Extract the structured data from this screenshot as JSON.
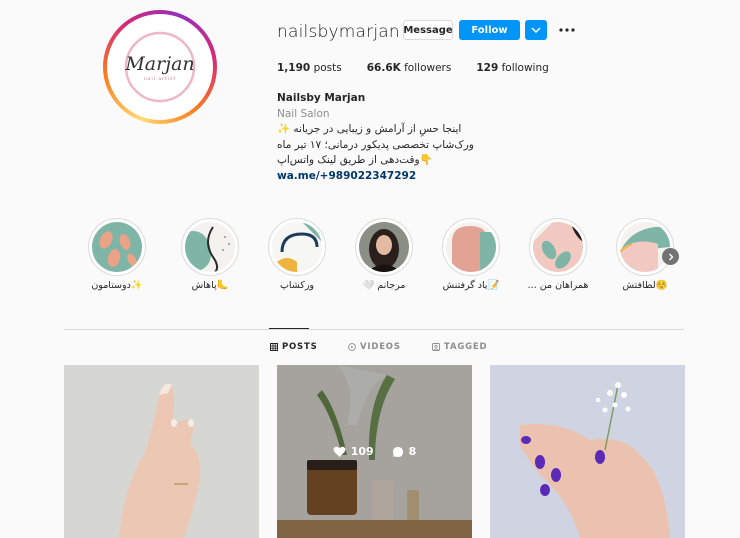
{
  "profile": {
    "username": "nailsbymarjan",
    "logo_text": "Marjan",
    "logo_subtext": "nail artist",
    "message_label": "Message",
    "follow_label": "Follow",
    "stats": {
      "posts_count": "1,190",
      "posts_label": "posts",
      "followers_count": "66.6K",
      "followers_label": "followers",
      "following_count": "129",
      "following_label": "following"
    },
    "bio": {
      "name": "Nailsby Marjan",
      "category": "Nail Salon",
      "line1": "اینجا حسِ از آرامش و زیبایی در جریانه ✨",
      "line2": "ورک‌شاپ تخصصی پدیکور درمانی؛ ۱۷ تیر ماه",
      "line3": "👇وقت‌دهی از طریق لینک واتس‌اپ",
      "link": "wa.me/+989022347292"
    }
  },
  "highlights": [
    {
      "label": "✨دوستامون",
      "icon": "leaf-pattern"
    },
    {
      "label": "🦶پاهاش",
      "icon": "abstract-curves"
    },
    {
      "label": "ورکشاپ",
      "icon": "workshop-shapes"
    },
    {
      "label": "مرجانم 🤍",
      "icon": "portrait-photo"
    },
    {
      "label": "📝یاد گرفتنش",
      "icon": "arch-shape"
    },
    {
      "label": "همراهان من ...",
      "icon": "leaf-pink"
    },
    {
      "label": "☺️لطافتش",
      "icon": "circle-shapes"
    }
  ],
  "tabs": [
    {
      "label": "POSTS",
      "icon": "grid-icon",
      "active": true
    },
    {
      "label": "VIDEOS",
      "icon": "video-icon",
      "active": false
    },
    {
      "label": "TAGGED",
      "icon": "tag-icon",
      "active": false
    }
  ],
  "posts": [
    {
      "desc": "hand-with-nails",
      "likes": null,
      "comments": null
    },
    {
      "desc": "salon-products",
      "likes": "109",
      "comments": "8"
    },
    {
      "desc": "hand-with-flowers",
      "likes": null,
      "comments": null
    }
  ],
  "colors": {
    "accent": "#0095f6",
    "link": "#00376b",
    "muted": "#8e8e8e"
  }
}
